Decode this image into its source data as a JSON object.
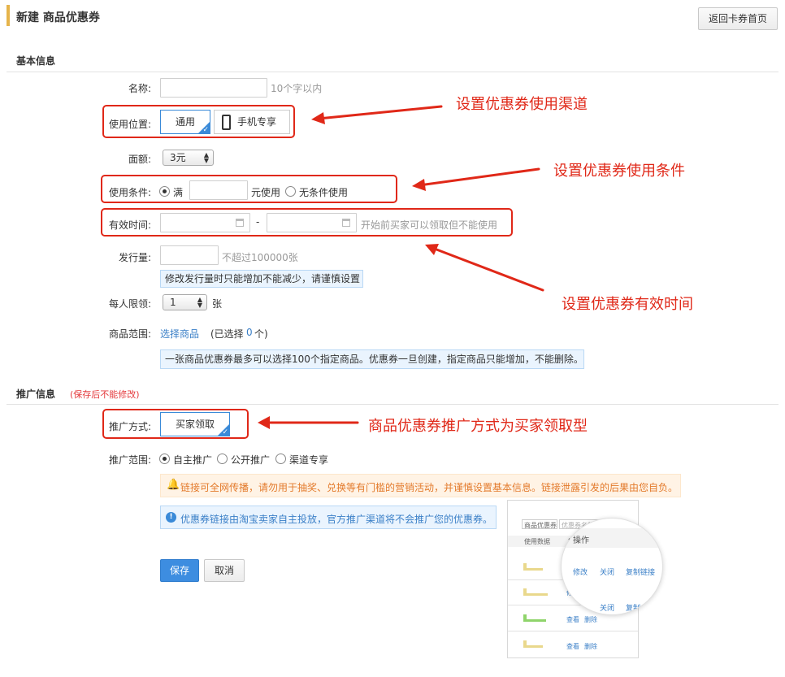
{
  "header": {
    "title": "新建 商品优惠券",
    "back_label": "返回卡券首页"
  },
  "basic_section": {
    "title": "基本信息"
  },
  "form": {
    "name": {
      "label": "名称:",
      "value": "",
      "hint": "10个字以内"
    },
    "position": {
      "label": "使用位置:",
      "options": [
        "通用",
        "手机专享"
      ],
      "selected": "通用",
      "icon": "mobile-icon"
    },
    "amount": {
      "label": "面额:",
      "value": "3元"
    },
    "condition": {
      "label": "使用条件:",
      "option_full": "满",
      "value": "",
      "suffix": "元使用",
      "option_none": "无条件使用",
      "selected": "满"
    },
    "validity": {
      "label": "有效时间:",
      "start": "",
      "end": "",
      "separator": "-",
      "hint": "开始前买家可以领取但不能使用",
      "icon": "calendar-icon"
    },
    "quantity": {
      "label": "发行量:",
      "value": "",
      "hint": "不超过100000张",
      "notice": "修改发行量时只能增加不能减少，请谨慎设置"
    },
    "limit": {
      "label": "每人限领:",
      "value": "1",
      "unit": "张"
    },
    "scope": {
      "label": "商品范围:",
      "link": "选择商品",
      "selected_prefix": "(已选择",
      "selected_count": "0",
      "selected_suffix": "个)",
      "notice": "一张商品优惠券最多可以选择100个指定商品。优惠券一旦创建，指定商品只能增加，不能删除。"
    }
  },
  "promo_section": {
    "title": "推广信息",
    "note": "(保存后不能修改)"
  },
  "promo": {
    "method": {
      "label": "推广方式:",
      "value": "买家领取"
    },
    "range": {
      "label": "推广范围:",
      "options": [
        "自主推广",
        "公开推广",
        "渠道专享"
      ],
      "selected": "自主推广"
    },
    "warning": "链接可全网传播，请勿用于抽奖、兑换等有门槛的营销活动，并谨慎设置基本信息。链接泄露引发的后果由您自负。",
    "info": "优惠券链接由淘宝卖家自主投放，官方推广渠道将不会推广您的优惠券。",
    "warning_icon": "bell-icon",
    "info_icon": "info-icon"
  },
  "actions": {
    "save": "保存",
    "cancel": "取消"
  },
  "preview": {
    "select_text": "商品优惠券",
    "search_placeholder": "优惠券名称",
    "col_usage": "使用数据",
    "col_op": "操",
    "mag_header": "操作",
    "mag_row1": [
      "修改",
      "关闭",
      "复制链接"
    ],
    "mag_row2": [
      "关闭",
      "复制"
    ],
    "row_link_small": "修",
    "row_links": [
      "查看",
      "删除"
    ]
  },
  "annotations": {
    "channel": "设置优惠券使用渠道",
    "condition": "设置优惠券使用条件",
    "validity": "设置优惠券有效时间",
    "promo": "商品优惠券推广方式为买家领取型"
  },
  "colors": {
    "annotation": "#e02818",
    "accent": "#3a8ad8",
    "title_bar": "#e6b44b",
    "save": "#3d8de0"
  }
}
